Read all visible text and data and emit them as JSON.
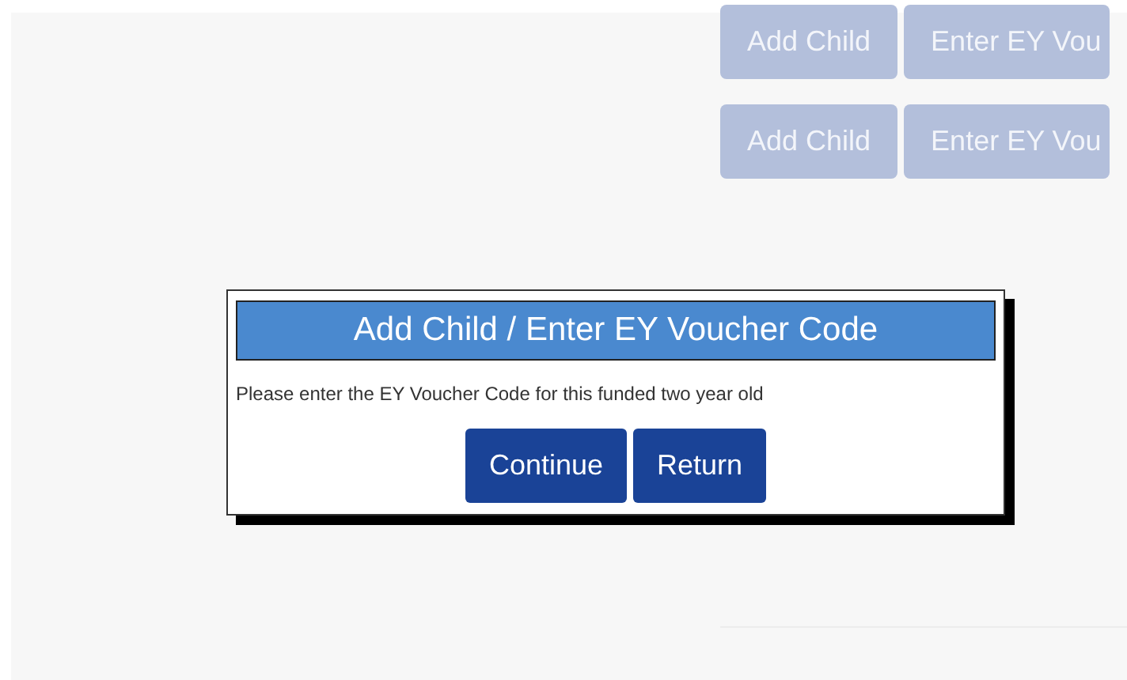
{
  "background_rows": [
    {
      "buttons": [
        "Add Child",
        "Enter EY Vou"
      ]
    },
    {
      "buttons": [
        "Add Child",
        "Enter EY Vou"
      ]
    }
  ],
  "dialog": {
    "title": "Add Child / Enter EY Voucher Code",
    "message": "Please enter the EY Voucher Code for this funded two year old",
    "buttons": [
      "Continue",
      "Return"
    ]
  }
}
